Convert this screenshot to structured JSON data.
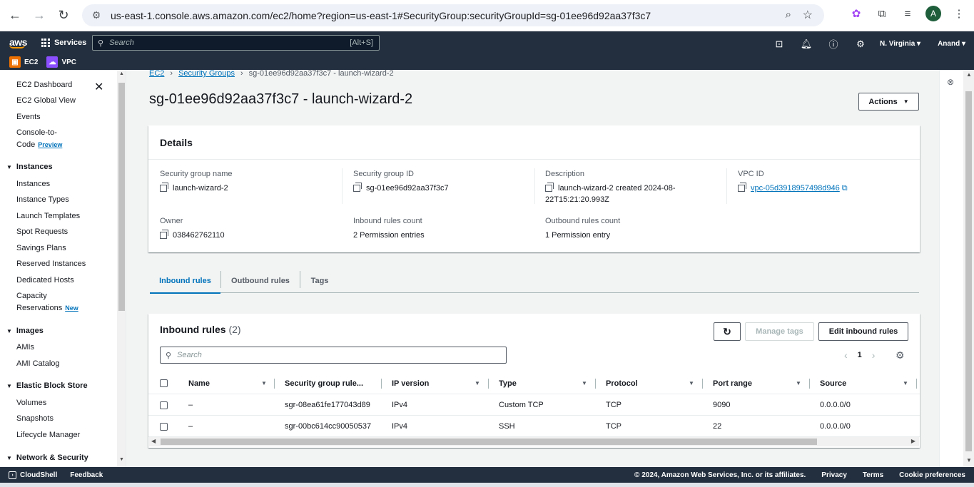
{
  "browser": {
    "url": "us-east-1.console.aws.amazon.com/ec2/home?region=us-east-1#SecurityGroup:securityGroupId=sg-01ee96d92aa37f3c7",
    "avatar_letter": "A"
  },
  "awsnav": {
    "logo": "aws",
    "services_label": "Services",
    "search_placeholder": "Search",
    "search_shortcut": "[Alt+S]",
    "region": "N. Virginia",
    "user": "Anand",
    "favorites": [
      {
        "label": "EC2",
        "color": "#ed7100"
      },
      {
        "label": "VPC",
        "color": "#8c4fff"
      }
    ]
  },
  "sidebar": {
    "top_items": [
      "EC2 Dashboard",
      "EC2 Global View",
      "Events"
    ],
    "console_to_code_1": "Console-to-",
    "console_to_code_2": "Code",
    "console_to_code_tag": "Preview",
    "instances_section": "Instances",
    "instances_items": [
      "Instances",
      "Instance Types",
      "Launch Templates",
      "Spot Requests",
      "Savings Plans",
      "Reserved Instances",
      "Dedicated Hosts"
    ],
    "capacity_1": "Capacity",
    "capacity_2": "Reservations",
    "capacity_tag": "New",
    "images_section": "Images",
    "images_items": [
      "AMIs",
      "AMI Catalog"
    ],
    "ebs_section": "Elastic Block Store",
    "ebs_items": [
      "Volumes",
      "Snapshots",
      "Lifecycle Manager"
    ],
    "network_section": "Network & Security"
  },
  "breadcrumb": {
    "root": "EC2",
    "parent": "Security Groups",
    "current": "sg-01ee96d92aa37f3c7 - launch-wizard-2"
  },
  "page_title": "sg-01ee96d92aa37f3c7 - launch-wizard-2",
  "actions_label": "Actions",
  "details": {
    "header": "Details",
    "sg_name_label": "Security group name",
    "sg_name": "launch-wizard-2",
    "sg_id_label": "Security group ID",
    "sg_id": "sg-01ee96d92aa37f3c7",
    "description_label": "Description",
    "description_1": "launch-wizard-2 created 2024-08-",
    "description_2": "22T15:21:20.993Z",
    "vpc_label": "VPC ID",
    "vpc_id": "vpc-05d3918957498d946",
    "owner_label": "Owner",
    "owner": "038462762110",
    "inbound_count_label": "Inbound rules count",
    "inbound_count": "2 Permission entries",
    "outbound_count_label": "Outbound rules count",
    "outbound_count": "1 Permission entry"
  },
  "tabs": [
    "Inbound rules",
    "Outbound rules",
    "Tags"
  ],
  "rules": {
    "title": "Inbound rules",
    "count": "(2)",
    "manage_tags": "Manage tags",
    "edit_rules": "Edit inbound rules",
    "search_placeholder": "Search",
    "page": "1",
    "columns": [
      "Name",
      "Security group rule...",
      "IP version",
      "Type",
      "Protocol",
      "Port range",
      "Source"
    ],
    "rows": [
      {
        "name": "–",
        "rule_id": "sgr-08ea61fe177043d89",
        "ip_version": "IPv4",
        "type": "Custom TCP",
        "protocol": "TCP",
        "port_range": "9090",
        "source": "0.0.0.0/0"
      },
      {
        "name": "–",
        "rule_id": "sgr-00bc614cc90050537",
        "ip_version": "IPv4",
        "type": "SSH",
        "protocol": "TCP",
        "port_range": "22",
        "source": "0.0.0.0/0"
      }
    ]
  },
  "footer": {
    "cloudshell": "CloudShell",
    "feedback": "Feedback",
    "copyright": "© 2024, Amazon Web Services, Inc. or its affiliates.",
    "privacy": "Privacy",
    "terms": "Terms",
    "cookies": "Cookie preferences"
  }
}
